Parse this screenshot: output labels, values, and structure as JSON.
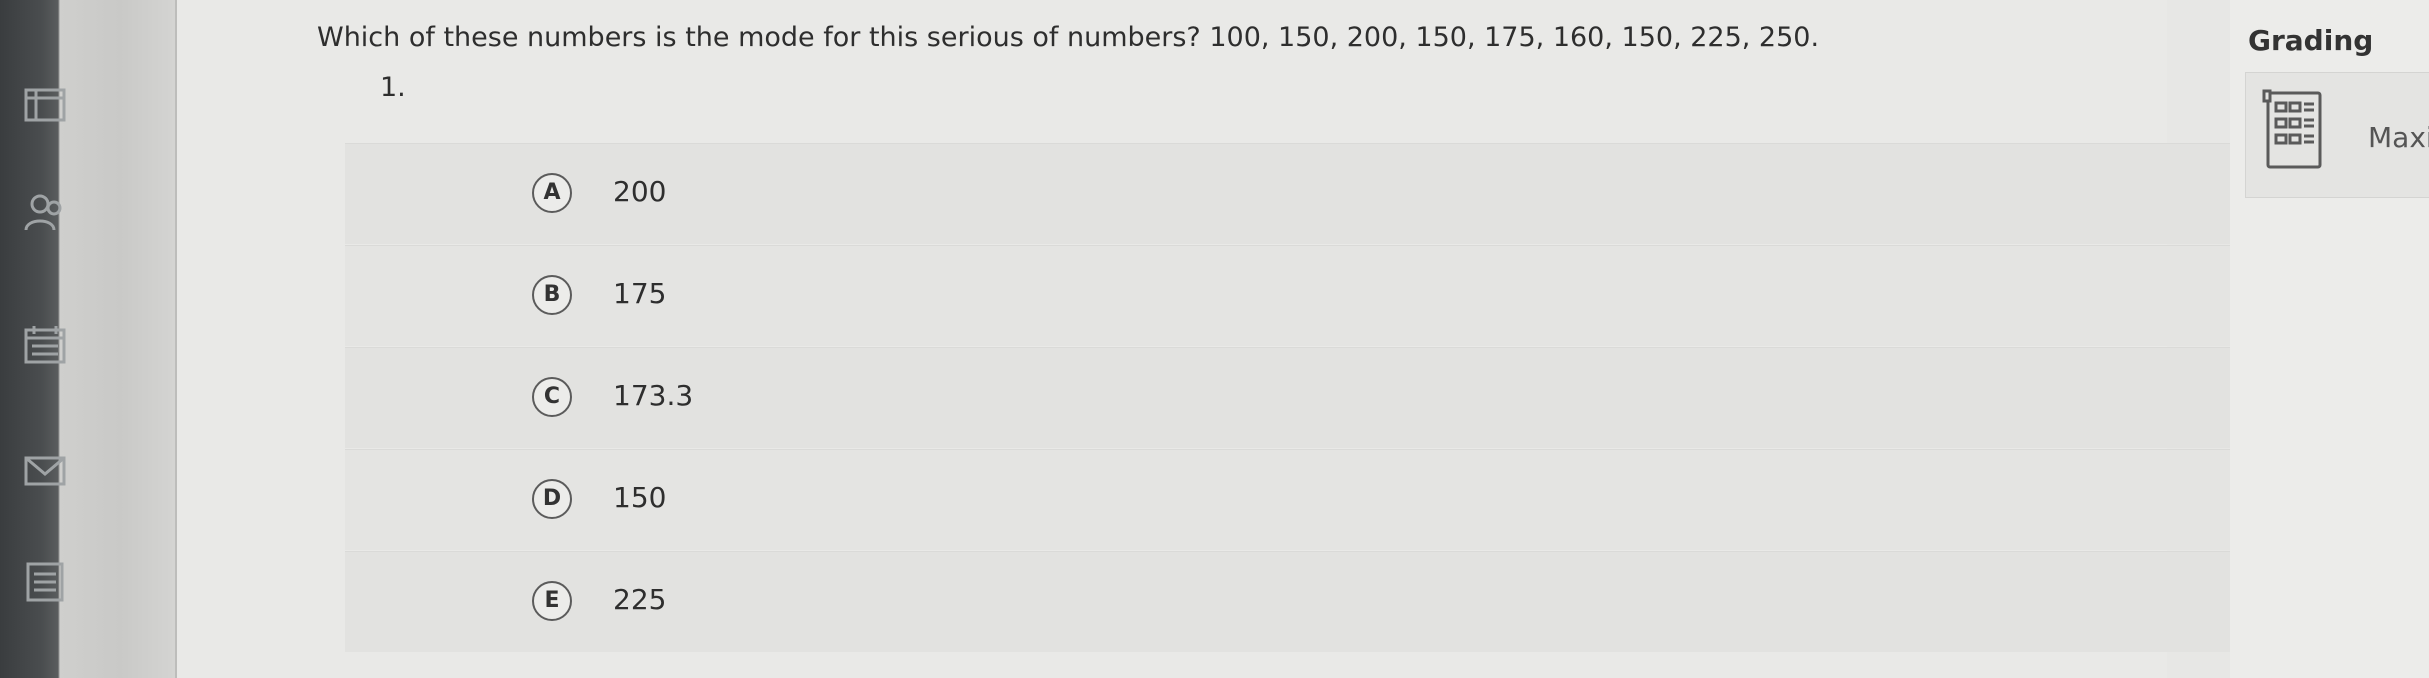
{
  "question": {
    "text": "Which of these numbers is the mode for this serious of numbers? 100, 150, 200, 150, 175, 160, 150, 225, 250.",
    "number": "1."
  },
  "options": [
    {
      "letter": "A",
      "value": "200"
    },
    {
      "letter": "B",
      "value": "175"
    },
    {
      "letter": "C",
      "value": "173.3"
    },
    {
      "letter": "D",
      "value": "150"
    },
    {
      "letter": "E",
      "value": "225"
    }
  ],
  "grading": {
    "title": "Grading",
    "card_label": "Maxi",
    "icon": "calculator-icon"
  },
  "sidebar": {
    "icons": [
      "toolbar-icon",
      "people-icon",
      "calendar-icon",
      "mail-icon",
      "notes-icon"
    ]
  }
}
